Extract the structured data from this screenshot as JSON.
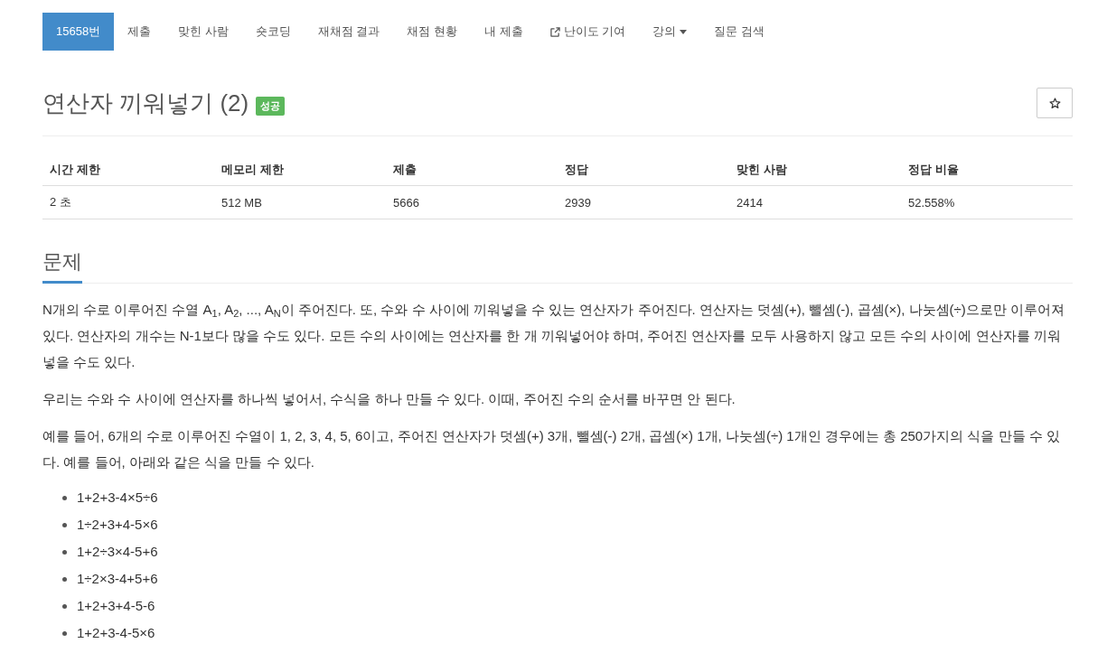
{
  "nav": {
    "items": [
      {
        "label": "15658번",
        "kind": "link",
        "selected": true
      },
      {
        "label": "제출",
        "kind": "link",
        "selected": false
      },
      {
        "label": "맞힌 사람",
        "kind": "link",
        "selected": false
      },
      {
        "label": "숏코딩",
        "kind": "link",
        "selected": false
      },
      {
        "label": "재채점 결과",
        "kind": "link",
        "selected": false
      },
      {
        "label": "채점 현황",
        "kind": "link",
        "selected": false
      },
      {
        "label": "내 제출",
        "kind": "link",
        "selected": false
      },
      {
        "label": "난이도 기여",
        "kind": "external",
        "selected": false
      },
      {
        "label": "강의",
        "kind": "dropdown",
        "selected": false
      },
      {
        "label": "질문 검색",
        "kind": "link",
        "selected": false
      }
    ]
  },
  "problem": {
    "title": "연산자 끼워넣기 (2)",
    "badge": "성공",
    "starred": false
  },
  "info_table": {
    "columns": [
      "시간 제한",
      "메모리 제한",
      "제출",
      "정답",
      "맞힌 사람",
      "정답 비율"
    ],
    "rows": [
      [
        "2 초",
        "512 MB",
        "5666",
        "2939",
        "2414",
        "52.558%"
      ]
    ]
  },
  "description": {
    "heading": "문제",
    "paragraphs": [
      "N개의 수로 이루어진 수열 A$_{1}$, A$_{2}$, ..., A$_{N}$이 주어진다. 또, 수와 수 사이에 끼워넣을 수 있는 연산자가 주어진다. 연산자는 덧셈(+), 뺄셈(-), 곱셈(×), 나눗셈(÷)으로만 이루어져 있다. 연산자의 개수는 N-1보다 많을 수도 있다. 모든 수의 사이에는 연산자를 한 개 끼워넣어야 하며, 주어진 연산자를 모두 사용하지 않고 모든 수의 사이에 연산자를 끼워넣을 수도 있다.",
      "우리는 수와 수 사이에 연산자를 하나씩 넣어서, 수식을 하나 만들 수 있다. 이때, 주어진 수의 순서를 바꾸면 안 된다.",
      "예를 들어, 6개의 수로 이루어진 수열이 1, 2, 3, 4, 5, 6이고, 주어진 연산자가 덧셈(+) 3개, 뺄셈(-) 2개, 곱셈(×) 1개, 나눗셈(÷) 1개인 경우에는 총 250가지의 식을 만들 수 있다. 예를 들어, 아래와 같은 식을 만들 수 있다."
    ],
    "examples": [
      "1+2+3-4×5÷6",
      "1÷2+3+4-5×6",
      "1+2÷3×4-5+6",
      "1÷2×3-4+5+6",
      "1+2+3+4-5-6",
      "1+2+3-4-5×6"
    ]
  }
}
